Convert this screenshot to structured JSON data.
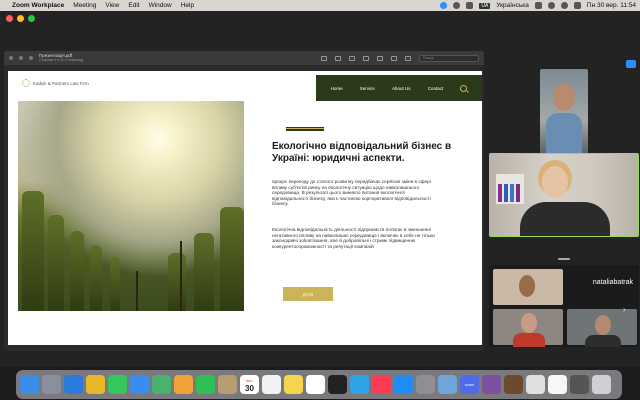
{
  "menubar": {
    "app_name": "Zoom Workplace",
    "menus": [
      "Meeting",
      "View",
      "Edit",
      "Window",
      "Help"
    ],
    "keyboard_lang": "Українська",
    "lang_badge": "UA",
    "date_time": "Пн 30 вер.  11:54"
  },
  "preview": {
    "file_title": "Презентація.pdf",
    "file_subtitle": "Сторінка 4 із 10 • Перегляд",
    "search_placeholder": "Пошук"
  },
  "slide": {
    "logo_text": "Kadiyk & Partners Law Firm",
    "nav": [
      "Home",
      "Service",
      "About Us",
      "Contact"
    ],
    "headline": "Екологічно відповідальний бізнес в Україні: юридичні аспекти.",
    "para1": "процес переходу до сталого розвитку передбачає серйозні зміни в сфері впливу суб'єктів ринку на екологічну ситуацію щодо навколишнього середовища. В результаті цього виникло питання екологічної відповідальності бізнесу, яка є частиною корпоративної відповідальності бізнесу.",
    "para2": "Екологічна відповідальність діяльності підприємств полягає в зменшенні негативного впливу на навколишнє середовище і включає в себе не тільки законодавчі зобов'язання, але й добровільні і стримк підвищенню конкурентоспроможності та репутації компаній",
    "button": "ДАЛІ"
  },
  "participants": {
    "active_speaker_name": "nataliabatrak"
  },
  "dock": {
    "calendar_month": "ВЕР.",
    "calendar_day": "30",
    "zoom_label": "zoom",
    "apps": [
      {
        "name": "finder",
        "color": "#3b8ee8"
      },
      {
        "name": "launchpad",
        "color": "#8a8fa0"
      },
      {
        "name": "safari",
        "color": "#2b7bdc"
      },
      {
        "name": "chrome",
        "color": "#e9b82a"
      },
      {
        "name": "messages",
        "color": "#35c759"
      },
      {
        "name": "mail",
        "color": "#3a8cf0"
      },
      {
        "name": "maps",
        "color": "#4ab36b"
      },
      {
        "name": "photos",
        "color": "#f1a33a"
      },
      {
        "name": "facetime",
        "color": "#2fbf55"
      },
      {
        "name": "contacts",
        "color": "#b89c74"
      },
      {
        "name": "reminders",
        "color": "#f2f2f2"
      },
      {
        "name": "notes",
        "color": "#f6d44d"
      },
      {
        "name": "freeform",
        "color": "#ffffff"
      },
      {
        "name": "appletv",
        "color": "#222222"
      },
      {
        "name": "telegram",
        "color": "#30a3e6"
      },
      {
        "name": "music",
        "color": "#fb3c53"
      },
      {
        "name": "appstore",
        "color": "#1f8df5"
      },
      {
        "name": "settings",
        "color": "#8e8e93"
      },
      {
        "name": "preview",
        "color": "#6fa5d8"
      },
      {
        "name": "chat",
        "color": "#4e6bea"
      },
      {
        "name": "viber",
        "color": "#7b519d"
      },
      {
        "name": "photo-doc",
        "color": "#6d4a2b"
      },
      {
        "name": "calc",
        "color": "#e0e0e0"
      },
      {
        "name": "textedit",
        "color": "#f7f7f7"
      },
      {
        "name": "screenshot",
        "color": "#555555"
      },
      {
        "name": "trash",
        "color": "#cfcfd4"
      }
    ]
  }
}
